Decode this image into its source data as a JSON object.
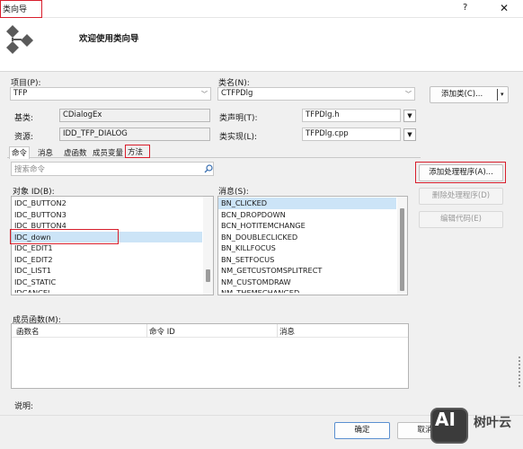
{
  "window": {
    "title": "类向导",
    "help_glyph": "?",
    "close_glyph": "✕"
  },
  "banner": {
    "welcome": "欢迎使用类向导"
  },
  "project": {
    "label": "项目(P):",
    "value": "TFP"
  },
  "classname": {
    "label": "类名(N):",
    "value": "CTFPDlg"
  },
  "add_class_button": "添加类(C)...",
  "base": {
    "label": "基类:",
    "value": "CDialogEx"
  },
  "resource": {
    "label": "资源:",
    "value": "IDD_TFP_DIALOG"
  },
  "class_decl": {
    "label": "类声明(T):",
    "value": "TFPDlg.h"
  },
  "class_impl": {
    "label": "类实现(L):",
    "value": "TFPDlg.cpp"
  },
  "tabs": [
    "命令",
    "消息",
    "虚函数",
    "成员变量",
    "方法"
  ],
  "search": {
    "placeholder": "搜索命令"
  },
  "object_ids": {
    "label": "对象 ID(B):",
    "items": [
      "IDC_BUTTON2",
      "IDC_BUTTON3",
      "IDC_BUTTON4",
      "IDC_down",
      "IDC_EDIT1",
      "IDC_EDIT2",
      "IDC_LIST1",
      "IDC_STATIC",
      "IDCANCEL"
    ]
  },
  "messages": {
    "label": "消息(S):",
    "items": [
      "BN_CLICKED",
      "BCN_DROPDOWN",
      "BCN_HOTITEMCHANGE",
      "BN_DOUBLECLICKED",
      "BN_KILLFOCUS",
      "BN_SETFOCUS",
      "NM_GETCUSTOMSPLITRECT",
      "NM_CUSTOMDRAW",
      "NM_THEMECHANGED"
    ]
  },
  "handler_buttons": {
    "add": "添加处理程序(A)...",
    "delete": "删除处理程序(D)",
    "edit": "编辑代码(E)"
  },
  "member_functions": {
    "label": "成员函数(M):",
    "columns": [
      "函数名",
      "命令 ID",
      "消息"
    ]
  },
  "description": {
    "label": "说明:"
  },
  "footer": {
    "ok": "确定",
    "cancel": "取消"
  },
  "watermark": {
    "logo": "AI",
    "text": "树叶云"
  },
  "colors": {
    "highlight_red": "#d81e2c",
    "selected_row": "#cce4f7"
  }
}
